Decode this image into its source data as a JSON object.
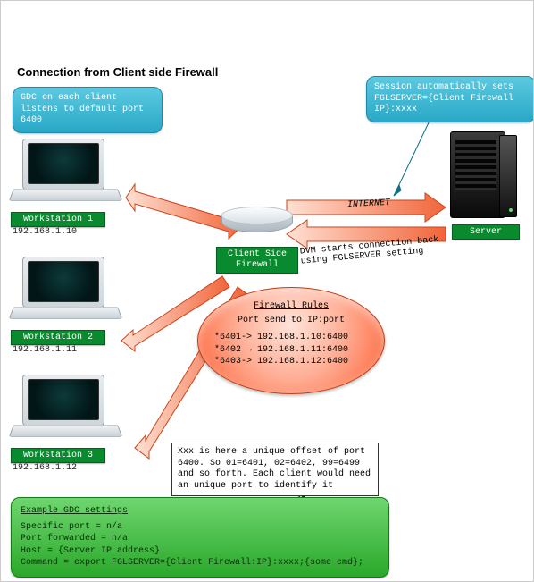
{
  "title": "Connection from Client side Firewall",
  "callouts": {
    "gdc_listen": "GDC on each client listens to default port 6400",
    "session_sets": "Session automatically sets FGLSERVER={Client Firewall IP}:xxxx"
  },
  "workstations": [
    {
      "name": "Workstation 1",
      "ip": "192.168.1.10"
    },
    {
      "name": "Workstation 2",
      "ip": "192.168.1.11"
    },
    {
      "name": "Workstation 3",
      "ip": "192.168.1.12"
    }
  ],
  "server_label": "Server",
  "firewall_label": "Client Side Firewall",
  "flow_labels": {
    "internet": "INTERNET",
    "dvm_back": "DVM starts connection back using FGLSERVER setting"
  },
  "firewall_rules": {
    "heading": "Firewall Rules",
    "sub": "Port send to IP:port",
    "rules": [
      "*6401-> 192.168.1.10:6400",
      "*6402 → 192.168.1.11:6400",
      "*6403-> 192.168.1.12:6400"
    ]
  },
  "offset_note": "Xxx is here a unique offset of port 6400. So 01=6401, 02=6402, 99=6499 and so forth. Each client would need an unique port to identify it",
  "gdc_settings": {
    "heading": "Example GDC settings",
    "lines": [
      "Specific port = n/a",
      "Port forwarded = n/a",
      "Host = {Server IP address}",
      "Command = export FGLSERVER={Client Firewall:IP}:xxxx;{some cmd};"
    ]
  }
}
